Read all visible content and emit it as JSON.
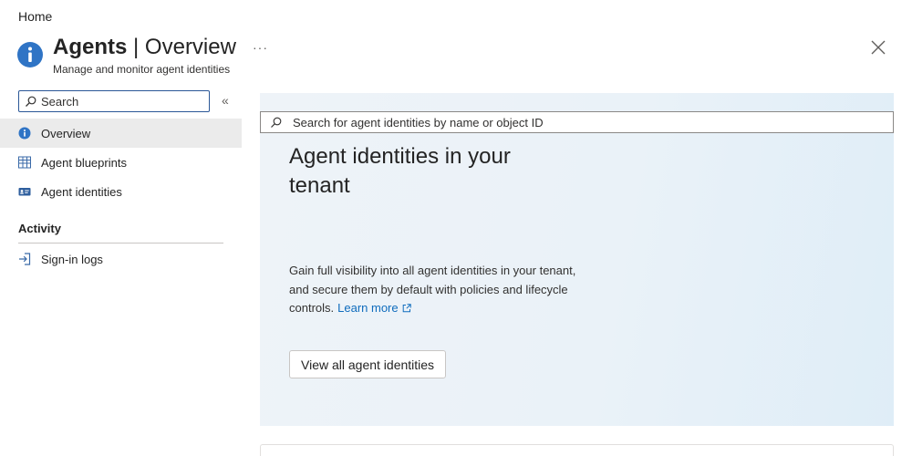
{
  "breadcrumb": {
    "home": "Home"
  },
  "header": {
    "title_main": "Agents",
    "title_sep": " | ",
    "title_sub": "Overview",
    "subtitle": "Manage and monitor agent identities",
    "more_label": "···",
    "icon": "info-icon"
  },
  "sidebar": {
    "search_placeholder": "Search",
    "collapse_label": "«",
    "items": [
      {
        "label": "Overview",
        "icon": "info-icon",
        "active": true
      },
      {
        "label": "Agent blueprints",
        "icon": "grid-icon",
        "active": false
      },
      {
        "label": "Agent identities",
        "icon": "id-card-icon",
        "active": false
      }
    ],
    "sections": [
      {
        "title": "Activity",
        "items": [
          {
            "label": "Sign-in logs",
            "icon": "sign-in-icon"
          }
        ]
      }
    ]
  },
  "main": {
    "search_placeholder": "Search for agent identities by name or object ID",
    "hero_title": "Agent identities in your tenant",
    "hero_description": "Gain full visibility into all agent identities in your tenant, and secure them by default with policies and lifecycle controls.",
    "learn_more": "Learn more",
    "view_all_button": "View all agent identities"
  },
  "colors": {
    "accent": "#0f6cbd",
    "info_icon": "#2f74c5",
    "active_nav_bg": "#ebebeb",
    "hero_bg": "#eaf2f8"
  }
}
